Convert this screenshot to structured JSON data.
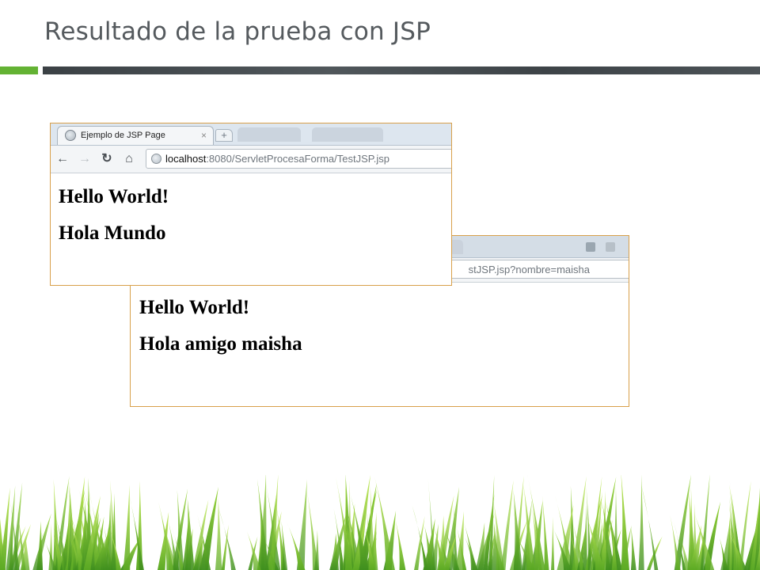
{
  "slide": {
    "title": "Resultado de la prueba con JSP"
  },
  "colors": {
    "accent_green": "#63b233",
    "dark_bar": "#444b4f",
    "title_text": "#555a5e",
    "browser_border": "#d8a04a"
  },
  "browser_front": {
    "tab_title": "Ejemplo de JSP Page",
    "tab_close": "×",
    "new_tab": "+",
    "nav": {
      "back": "←",
      "forward": "→",
      "reload": "↻",
      "home": "⌂"
    },
    "url_host": "localhost",
    "url_rest": ":8080/ServletProcesaForma/TestJSP.jsp",
    "headings": [
      "Hello World!",
      "Hola Mundo"
    ]
  },
  "browser_back": {
    "url_visible": "stJSP.jsp?nombre=maisha",
    "headings": [
      "Hello World!",
      "Hola amigo maisha"
    ]
  },
  "icons": {
    "tab_favicon": "globe-icon",
    "omnibox_icon": "globe-icon",
    "decoration": "grass-decoration"
  }
}
